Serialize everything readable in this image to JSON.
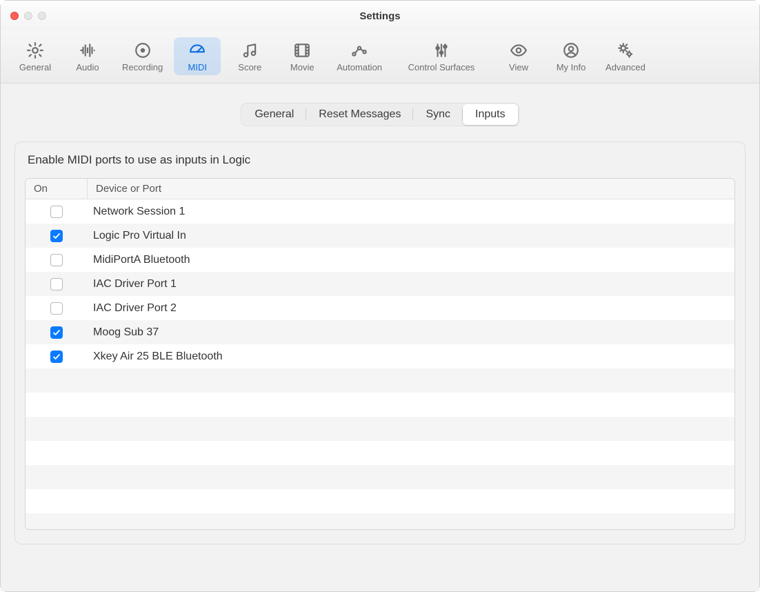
{
  "window": {
    "title": "Settings"
  },
  "toolbar": {
    "items": [
      {
        "id": "general",
        "label": "General",
        "active": false
      },
      {
        "id": "audio",
        "label": "Audio",
        "active": false
      },
      {
        "id": "recording",
        "label": "Recording",
        "active": false
      },
      {
        "id": "midi",
        "label": "MIDI",
        "active": true
      },
      {
        "id": "score",
        "label": "Score",
        "active": false
      },
      {
        "id": "movie",
        "label": "Movie",
        "active": false
      },
      {
        "id": "automation",
        "label": "Automation",
        "active": false
      },
      {
        "id": "controlsurfaces",
        "label": "Control Surfaces",
        "active": false,
        "wide": true
      },
      {
        "id": "view",
        "label": "View",
        "active": false
      },
      {
        "id": "myinfo",
        "label": "My Info",
        "active": false
      },
      {
        "id": "advanced",
        "label": "Advanced",
        "active": false
      }
    ]
  },
  "segments": [
    {
      "id": "general",
      "label": "General",
      "active": false
    },
    {
      "id": "reset-messages",
      "label": "Reset Messages",
      "active": false
    },
    {
      "id": "sync",
      "label": "Sync",
      "active": false
    },
    {
      "id": "inputs",
      "label": "Inputs",
      "active": true
    }
  ],
  "panel": {
    "description": "Enable MIDI ports to use as inputs in Logic",
    "columns": {
      "on": "On",
      "device": "Device or Port"
    },
    "rows": [
      {
        "checked": false,
        "label": "Network Session 1"
      },
      {
        "checked": true,
        "label": "Logic Pro Virtual In"
      },
      {
        "checked": false,
        "label": "MidiPortA Bluetooth"
      },
      {
        "checked": false,
        "label": "IAC Driver Port 1"
      },
      {
        "checked": false,
        "label": "IAC Driver Port 2"
      },
      {
        "checked": true,
        "label": "Moog Sub 37"
      },
      {
        "checked": true,
        "label": "Xkey Air 25 BLE Bluetooth"
      }
    ],
    "empty_rows": 7
  },
  "icons": {
    "general": "gear-icon",
    "audio": "waveform-icon",
    "recording": "record-icon",
    "midi": "gauge-icon",
    "score": "notes-icon",
    "movie": "film-icon",
    "automation": "automation-icon",
    "controlsurfaces": "sliders-icon",
    "view": "eye-icon",
    "myinfo": "user-circle-icon",
    "advanced": "gears-icon"
  },
  "colors": {
    "accent": "#0a7bff",
    "toolbar_active_text": "#0a6de1"
  }
}
